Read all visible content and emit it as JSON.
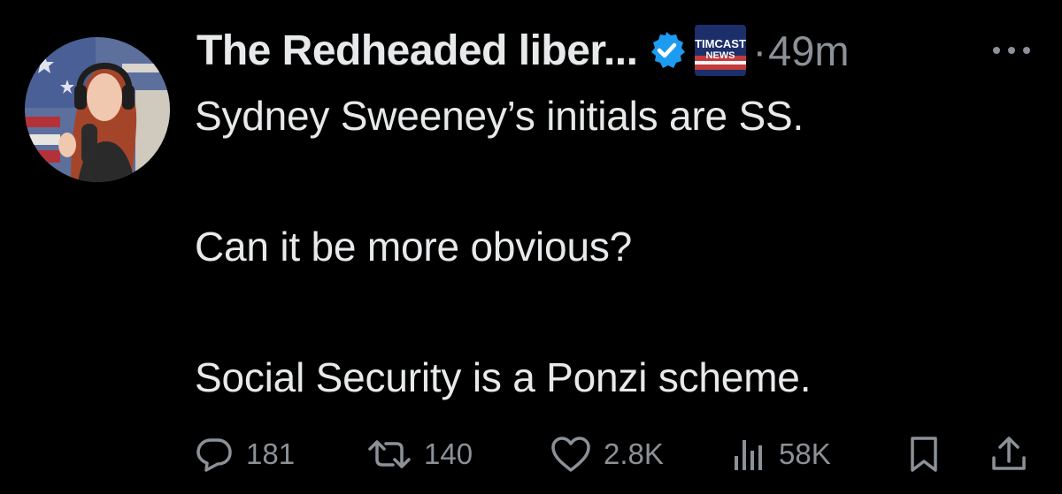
{
  "tweet": {
    "display_name": "The Redheaded liber...",
    "affiliation_badge_text": [
      "TIMCAST",
      "NEWS"
    ],
    "separator": "·",
    "timestamp": "49m",
    "lines": [
      "Sydney Sweeney’s initials are SS.",
      "Can it be more obvious?",
      "Social Security is a Ponzi scheme."
    ]
  },
  "actions": {
    "replies": "181",
    "reposts": "140",
    "likes": "2.8K",
    "views": "58K"
  },
  "icons": {
    "verified": "verified-badge-icon",
    "more": "more-icon",
    "reply": "reply-icon",
    "repost": "repost-icon",
    "like": "like-icon",
    "views": "views-icon",
    "bookmark": "bookmark-icon",
    "share": "share-icon"
  },
  "colors": {
    "background": "#000000",
    "text": "#e7e9ea",
    "secondary": "#8b9197",
    "verified_blue": "#1d9bf0"
  }
}
